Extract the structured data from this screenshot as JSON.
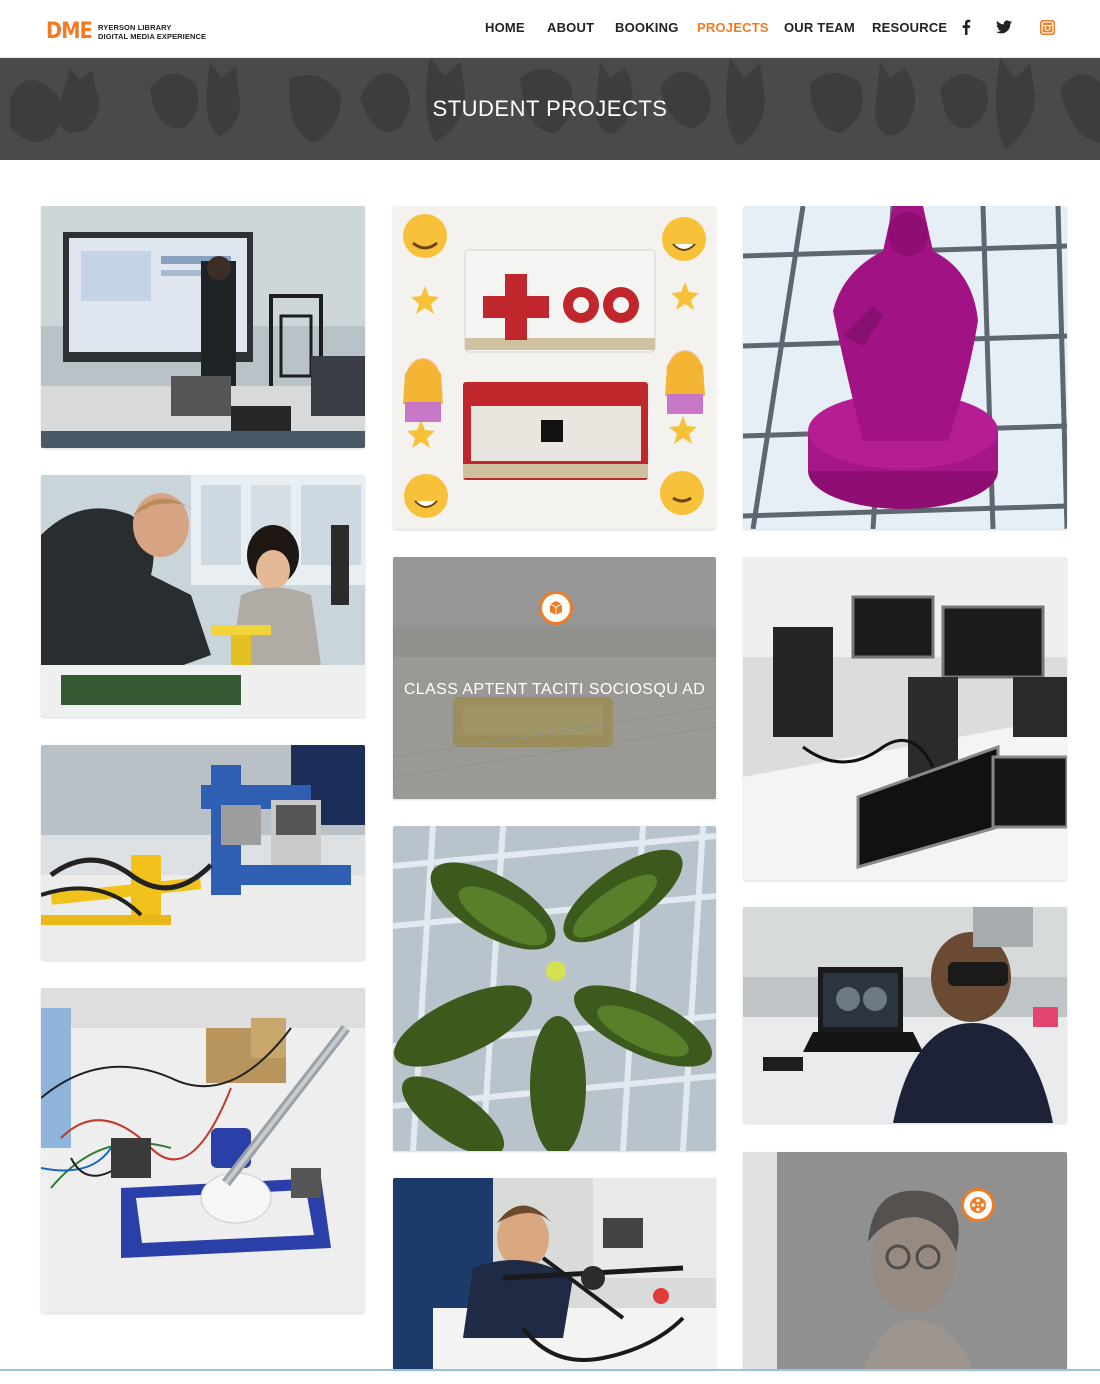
{
  "brand": {
    "mark": "DME",
    "line1": "RYERSON LIBRARY",
    "line2": "DIGITAL MEDIA EXPERIENCE",
    "accent_color": "#f07b22"
  },
  "nav": {
    "items": [
      {
        "label": "HOME"
      },
      {
        "label": "ABOUT"
      },
      {
        "label": "BOOKING"
      },
      {
        "label": "PROJECTS"
      },
      {
        "label": "OUR TEAM"
      },
      {
        "label": "RESOURCE"
      }
    ],
    "active": "PROJECTS",
    "social": [
      "facebook-icon",
      "twitter-icon",
      "instagram-icon"
    ]
  },
  "banner": {
    "title": "STUDENT PROJECTS"
  },
  "projects": {
    "featured_title": "CLASS APTENT TACITI SOCIOSQU AD",
    "tiles": [
      {
        "image": "screen-workstation-photo"
      },
      {
        "image": "makey-makey-boards-photo"
      },
      {
        "image": "3d-printed-figure-photo"
      },
      {
        "image": "students-soldering-photo"
      },
      {
        "image": "featured-project-overlay",
        "icon": "cube-icon"
      },
      {
        "image": "computer-monitors-photo"
      },
      {
        "image": "lego-robotics-photo"
      },
      {
        "image": "plant-leaves-photo"
      },
      {
        "image": "vr-headset-user-photo"
      },
      {
        "image": "drawing-robot-photo"
      },
      {
        "image": "drone-build-photo"
      },
      {
        "image": "portrait-video-overlay",
        "icon": "film-reel-icon"
      }
    ]
  }
}
